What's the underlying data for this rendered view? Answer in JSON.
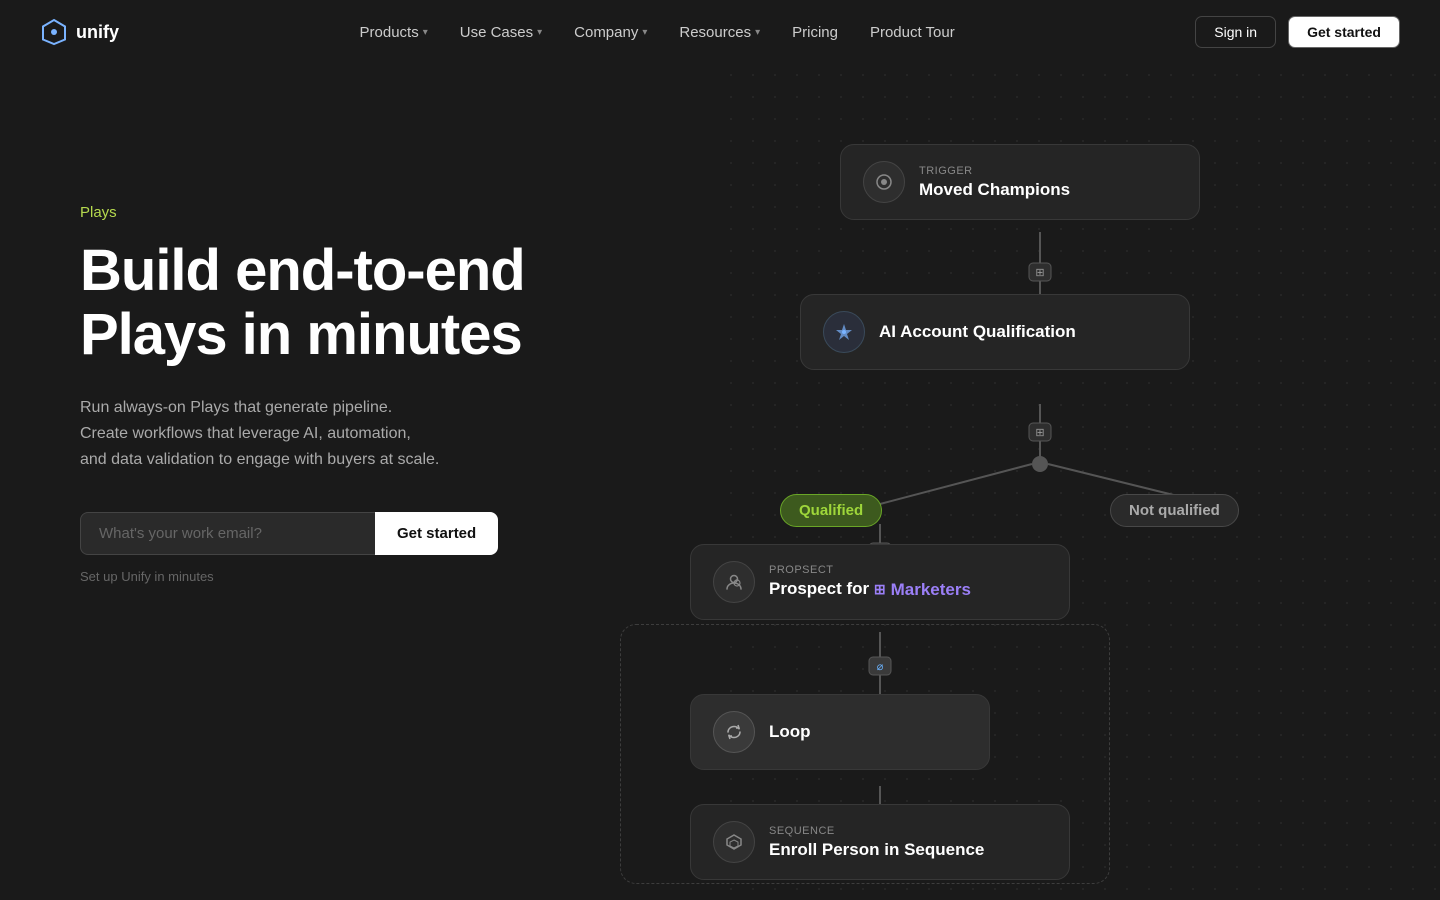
{
  "brand": {
    "name": "unify",
    "logo_icon": "⬡"
  },
  "nav": {
    "links": [
      {
        "label": "Products",
        "has_chevron": true
      },
      {
        "label": "Use Cases",
        "has_chevron": true
      },
      {
        "label": "Company",
        "has_chevron": true
      },
      {
        "label": "Resources",
        "has_chevron": true
      },
      {
        "label": "Pricing",
        "has_chevron": false
      },
      {
        "label": "Product Tour",
        "has_chevron": false
      }
    ],
    "signin_label": "Sign in",
    "getstarted_label": "Get started"
  },
  "hero": {
    "label": "Plays",
    "title_line1": "Build end-to-end",
    "title_line2": "Plays in minutes",
    "description": "Run always-on Plays that generate pipeline.\nCreate workflows that leverage AI, automation,\nand data validation to engage with buyers at scale.",
    "email_placeholder": "What's your work email?",
    "cta_label": "Get started",
    "note": "Set up Unify in minutes"
  },
  "workflow": {
    "trigger_label": "Trigger",
    "trigger_title": "Moved Champions",
    "ai_label": "AI Account Qualification",
    "qualified_label": "Qualified",
    "not_qualified_label": "Not qualified",
    "prospect_label": "Propsect",
    "prospect_desc": "Prospect for",
    "marketers_label": "Marketers",
    "loop_label": "Loop",
    "sequence_label": "Sequence",
    "sequence_desc": "Enroll Person in Sequence"
  }
}
